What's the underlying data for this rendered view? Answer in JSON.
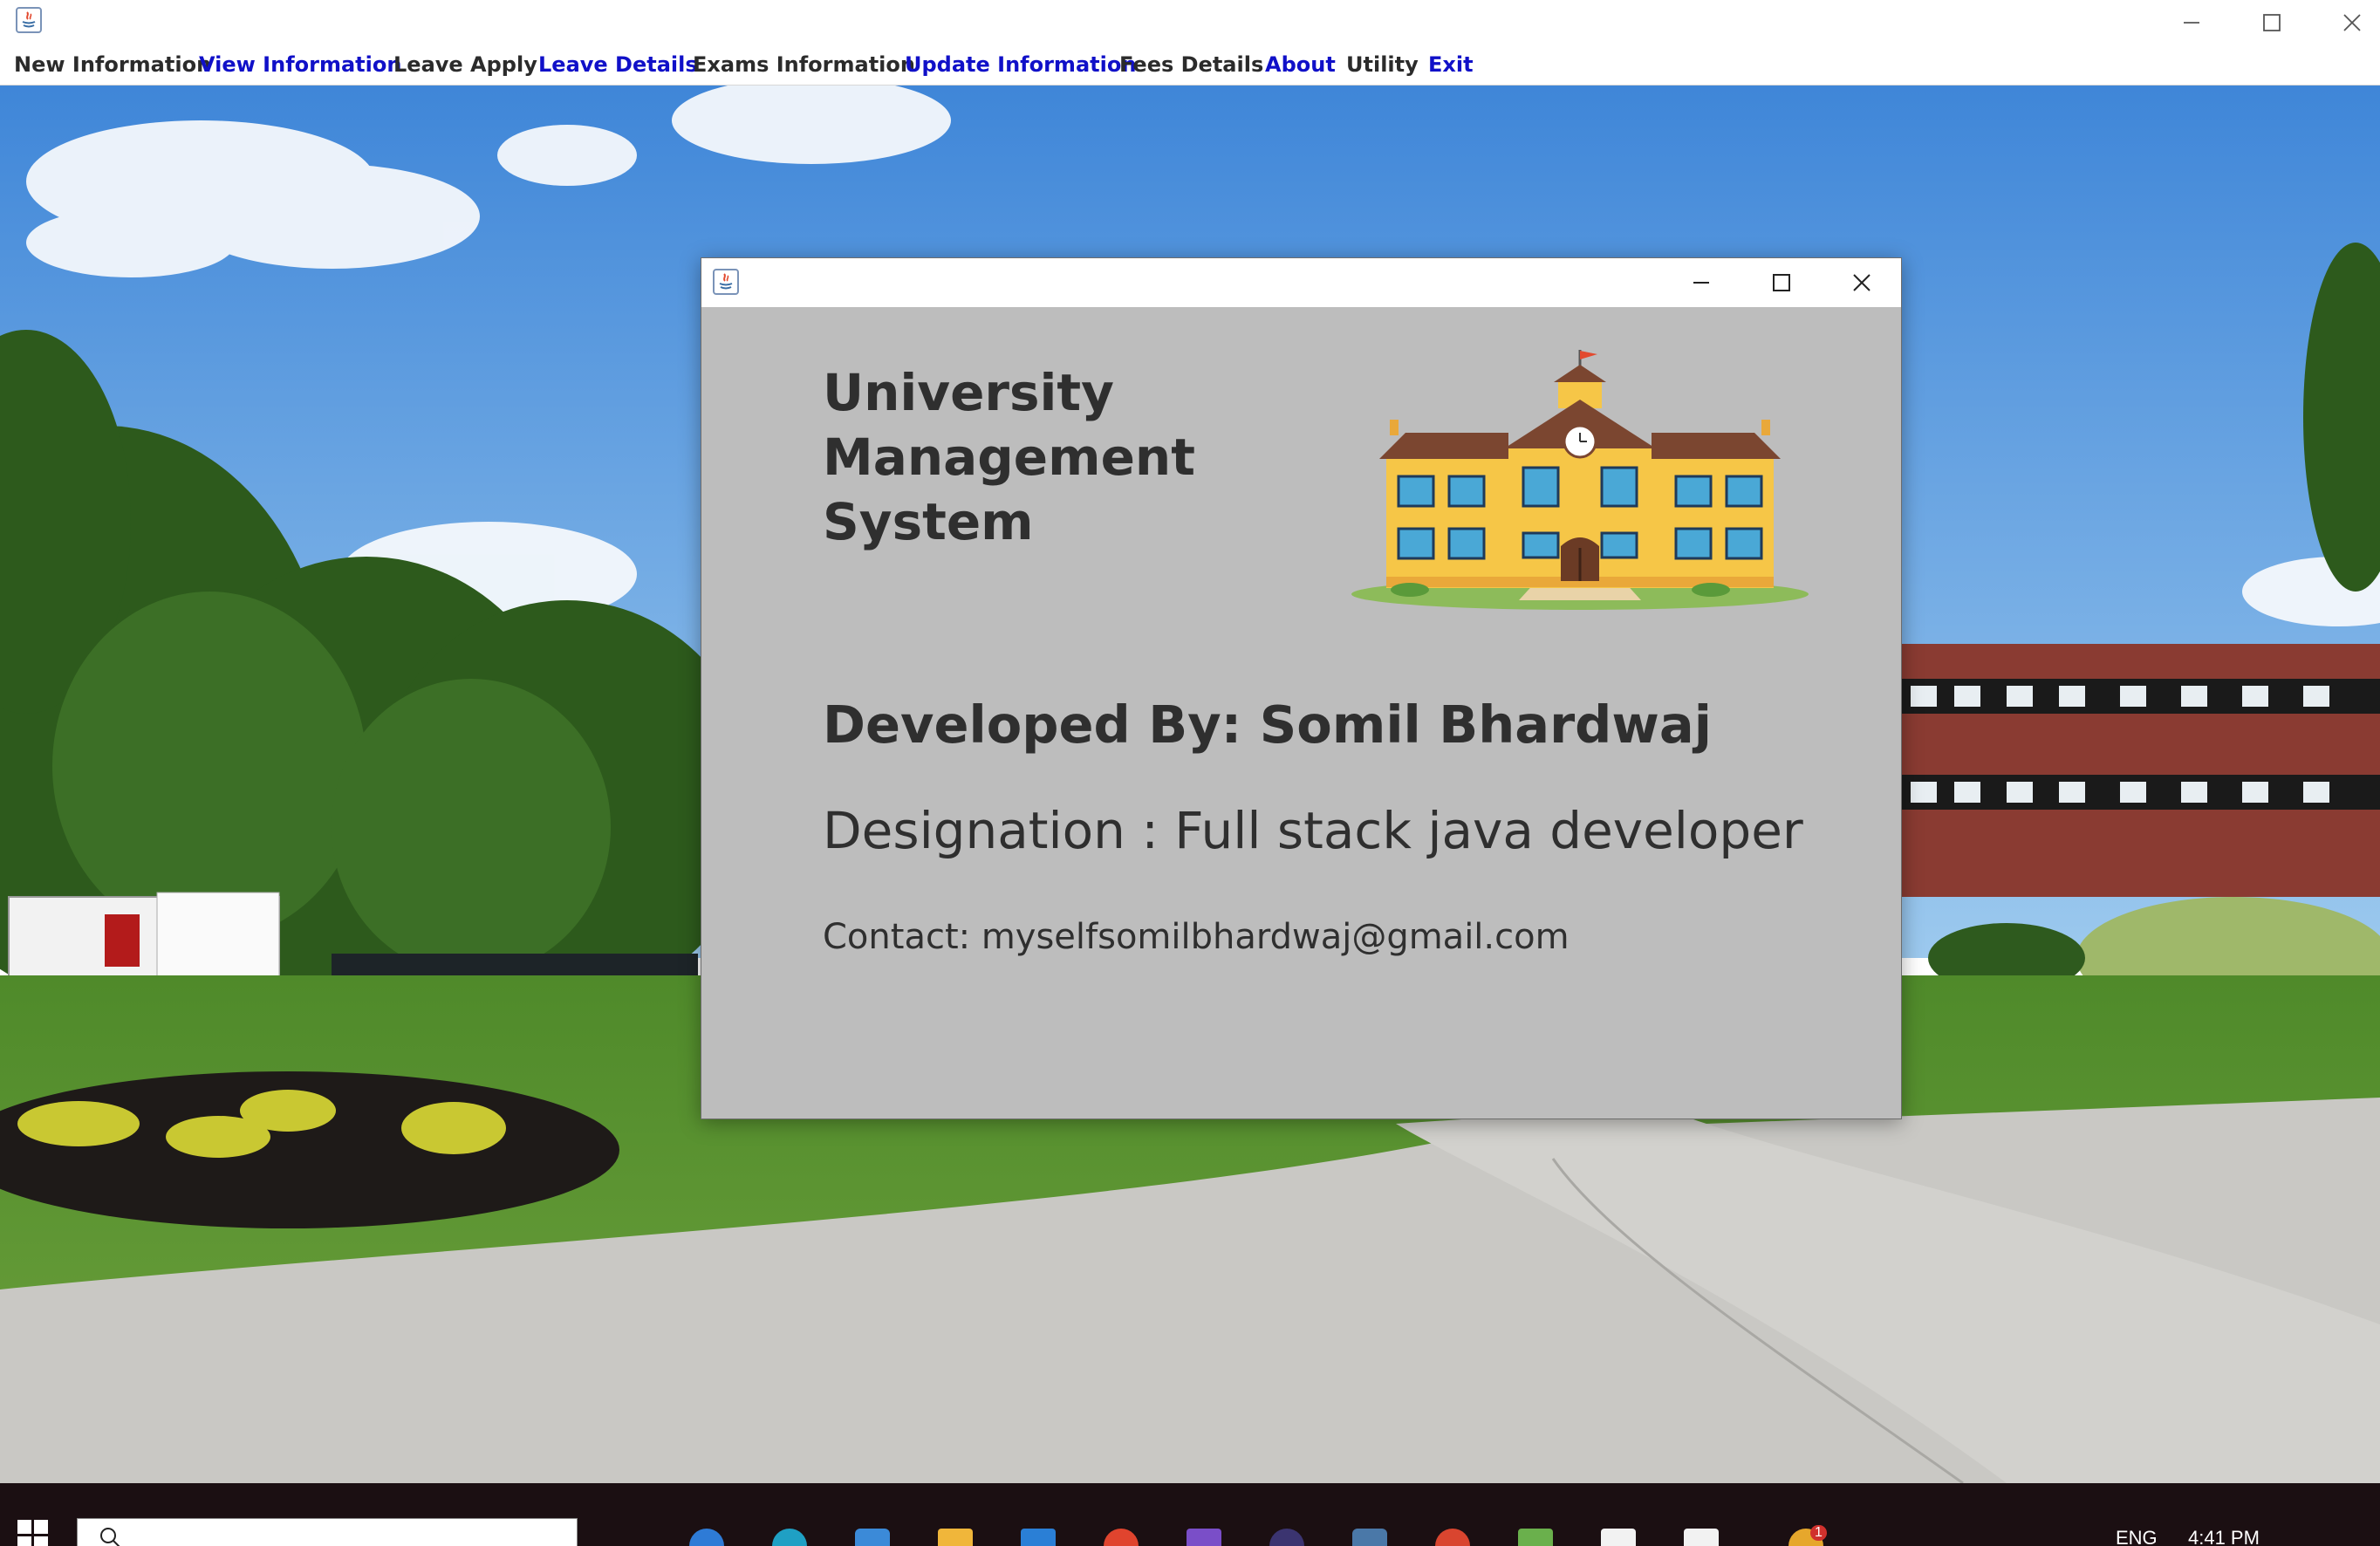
{
  "window": {
    "title": "",
    "controls": [
      "minimize",
      "maximize",
      "close"
    ]
  },
  "menubar": {
    "items": [
      {
        "label": "New Information",
        "color": "#2b2b2b"
      },
      {
        "label": "View Information",
        "color": "#1010c8"
      },
      {
        "label": "Leave Apply",
        "color": "#2b2b2b"
      },
      {
        "label": "Leave Details",
        "color": "#1010c8"
      },
      {
        "label": "Exams Information",
        "color": "#2b2b2b"
      },
      {
        "label": "Update Information",
        "color": "#1010c8"
      },
      {
        "label": "Fees Details",
        "color": "#2b2b2b"
      },
      {
        "label": "About",
        "color": "#1010c8"
      },
      {
        "label": "Utility",
        "color": "#2b2b2b"
      },
      {
        "label": "Exit",
        "color": "#1010c8"
      }
    ]
  },
  "dialog": {
    "title": "",
    "app_title_lines": [
      "University",
      "Management",
      "System"
    ],
    "developer": "Developed By: Somil Bhardwaj",
    "designation": "Designation : Full stack java developer",
    "contact": "Contact: myselfsomilbhardwaj@gmail.com",
    "image": "school-building-illustration",
    "background": "#bdbdbd"
  },
  "background": {
    "image": "university-campus-photo"
  },
  "taskbar": {
    "language": "ENG",
    "time": "4:41 PM",
    "notification_badge": "1"
  },
  "icons": [
    "java-app-icon",
    "minimize-icon",
    "maximize-icon",
    "close-icon",
    "windows-start-icon",
    "search-icon"
  ]
}
